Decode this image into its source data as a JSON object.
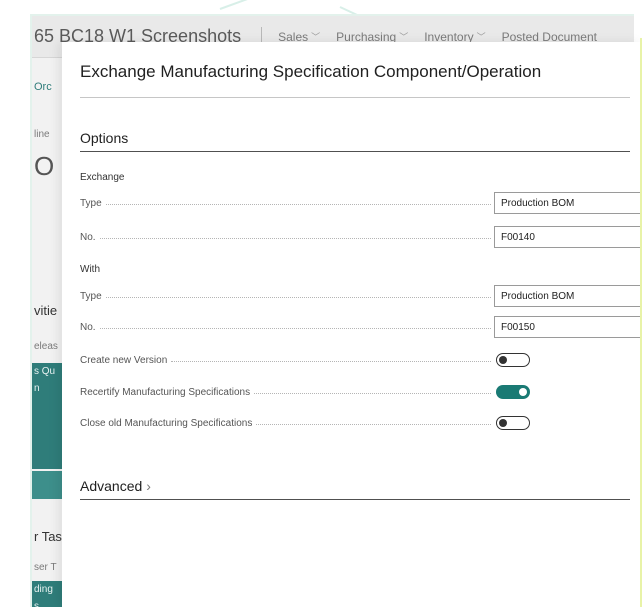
{
  "background_app": {
    "title": "65 BC18 W1 Screenshots",
    "menu": [
      "Sales",
      "Purchasing",
      "Inventory",
      "Posted Document"
    ],
    "side_fragments": [
      "Orc",
      "line",
      "O",
      "vitie",
      "eleas",
      "s Qu",
      "n",
      "r Tas",
      "ser T",
      "ding",
      "s"
    ]
  },
  "dialog": {
    "title": "Exchange Manufacturing Specification Component/Operation",
    "options_header": "Options",
    "exchange_label": "Exchange",
    "with_label": "With",
    "advanced_header": "Advanced",
    "fields": {
      "exchange_type": {
        "label": "Type",
        "value": "Production BOM"
      },
      "exchange_no": {
        "label": "No.",
        "value": "F00140"
      },
      "with_type": {
        "label": "Type",
        "value": "Production BOM"
      },
      "with_no": {
        "label": "No.",
        "value": "F00150"
      },
      "create_new_version": {
        "label": "Create new Version",
        "checked": false
      },
      "recertify": {
        "label": "Recertify Manufacturing Specifications",
        "checked": true
      },
      "close_old": {
        "label": "Close old Manufacturing Specifications",
        "checked": false
      }
    }
  },
  "colors": {
    "accent": "#1a7a74",
    "side_block": "#2f7d7a"
  }
}
